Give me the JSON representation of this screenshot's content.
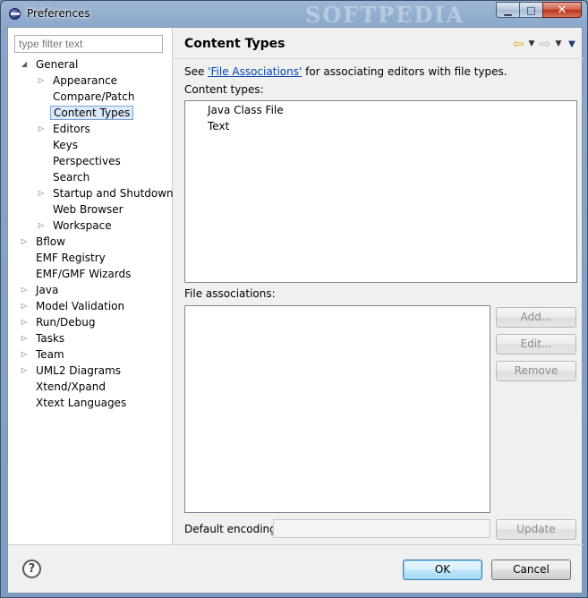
{
  "window": {
    "title": "Preferences",
    "watermark": "SOFTPEDIA",
    "controls": {
      "minimize": "▁",
      "maximize": "□",
      "close": "✕"
    }
  },
  "sidebar": {
    "filter_placeholder": "type filter text",
    "tree": [
      {
        "label": "General",
        "level": 0,
        "twisty": "expanded"
      },
      {
        "label": "Appearance",
        "level": 1,
        "twisty": "collapsed"
      },
      {
        "label": "Compare/Patch",
        "level": 1,
        "twisty": "none"
      },
      {
        "label": "Content Types",
        "level": 1,
        "twisty": "none",
        "selected": true
      },
      {
        "label": "Editors",
        "level": 1,
        "twisty": "collapsed"
      },
      {
        "label": "Keys",
        "level": 1,
        "twisty": "none"
      },
      {
        "label": "Perspectives",
        "level": 1,
        "twisty": "none"
      },
      {
        "label": "Search",
        "level": 1,
        "twisty": "none"
      },
      {
        "label": "Startup and Shutdown",
        "level": 1,
        "twisty": "collapsed"
      },
      {
        "label": "Web Browser",
        "level": 1,
        "twisty": "none"
      },
      {
        "label": "Workspace",
        "level": 1,
        "twisty": "collapsed"
      },
      {
        "label": "Bflow",
        "level": 0,
        "twisty": "collapsed"
      },
      {
        "label": "EMF Registry",
        "level": 0,
        "twisty": "none"
      },
      {
        "label": "EMF/GMF Wizards",
        "level": 0,
        "twisty": "none"
      },
      {
        "label": "Java",
        "level": 0,
        "twisty": "collapsed"
      },
      {
        "label": "Model Validation",
        "level": 0,
        "twisty": "collapsed"
      },
      {
        "label": "Run/Debug",
        "level": 0,
        "twisty": "collapsed"
      },
      {
        "label": "Tasks",
        "level": 0,
        "twisty": "collapsed"
      },
      {
        "label": "Team",
        "level": 0,
        "twisty": "collapsed"
      },
      {
        "label": "UML2 Diagrams",
        "level": 0,
        "twisty": "collapsed"
      },
      {
        "label": "Xtend/Xpand",
        "level": 0,
        "twisty": "none"
      },
      {
        "label": "Xtext Languages",
        "level": 0,
        "twisty": "none"
      }
    ]
  },
  "page": {
    "title": "Content Types",
    "see_prefix": "See ",
    "see_link": "'File Associations'",
    "see_suffix": " for associating editors with file types.",
    "content_types_label": "Content types:",
    "content_types": [
      "Java Class File",
      "Text"
    ],
    "file_associations_label": "File associations:",
    "add_label": "Add...",
    "edit_label": "Edit...",
    "remove_label": "Remove",
    "default_encoding_label": "Default encoding:",
    "default_encoding_value": "",
    "update_label": "Update"
  },
  "footer": {
    "help_label": "?",
    "ok_label": "OK",
    "cancel_label": "Cancel"
  }
}
